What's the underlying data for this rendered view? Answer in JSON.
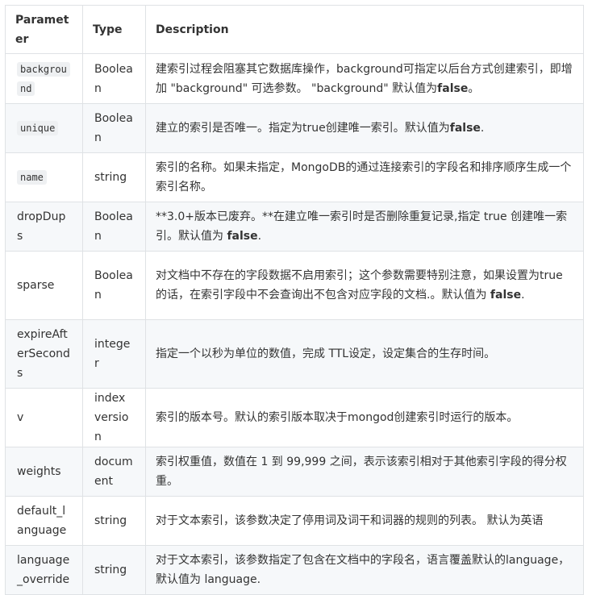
{
  "headers": {
    "parameter": "Parameter",
    "type": "Type",
    "description": "Description"
  },
  "rows": [
    {
      "parameter": "background",
      "type": "Boolean",
      "desc_pre": "建索引过程会阻塞其它数据库操作，background可指定以后台方式创建索引，即增加 \"background\" 可选参数。 \"background\" 默认值为",
      "desc_bold": "false",
      "desc_post": "。"
    },
    {
      "parameter": "unique",
      "type": "Boolean",
      "desc_pre": "建立的索引是否唯一。指定为true创建唯一索引。默认值为",
      "desc_bold": "false",
      "desc_post": "."
    },
    {
      "parameter": "name",
      "type": "string",
      "desc": "索引的名称。如果未指定，MongoDB的通过连接索引的字段名和排序顺序生成一个索引名称。"
    },
    {
      "parameter": "dropDups",
      "type": "Boolean",
      "desc_pre": "**3.0+版本已废弃。**在建立唯一索引时是否删除重复记录,指定 true 创建唯一索引。默认值为 ",
      "desc_bold": "false",
      "desc_post": "."
    },
    {
      "parameter": "sparse",
      "type": "Boolean",
      "desc_pre": "对文档中不存在的字段数据不启用索引；这个参数需要特别注意，如果设置为true的话，在索引字段中不会查询出不包含对应字段的文档.。默认值为 ",
      "desc_bold": "false",
      "desc_post": "."
    },
    {
      "parameter": "expireAfterSeconds",
      "type": "integer",
      "desc": "指定一个以秒为单位的数值，完成 TTL设定，设定集合的生存时间。"
    },
    {
      "parameter": "v",
      "type": "index version",
      "desc": "索引的版本号。默认的索引版本取决于mongod创建索引时运行的版本。"
    },
    {
      "parameter": "weights",
      "type": "document",
      "desc": "索引权重值，数值在 1 到 99,999 之间，表示该索引相对于其他索引字段的得分权重。"
    },
    {
      "parameter": "default_language",
      "type": "string",
      "desc": "对于文本索引，该参数决定了停用词及词干和词器的规则的列表。 默认为英语"
    },
    {
      "parameter": "language_override",
      "type": "string",
      "desc": "对于文本索引，该参数指定了包含在文档中的字段名，语言覆盖默认的language，默认值为 language."
    }
  ]
}
